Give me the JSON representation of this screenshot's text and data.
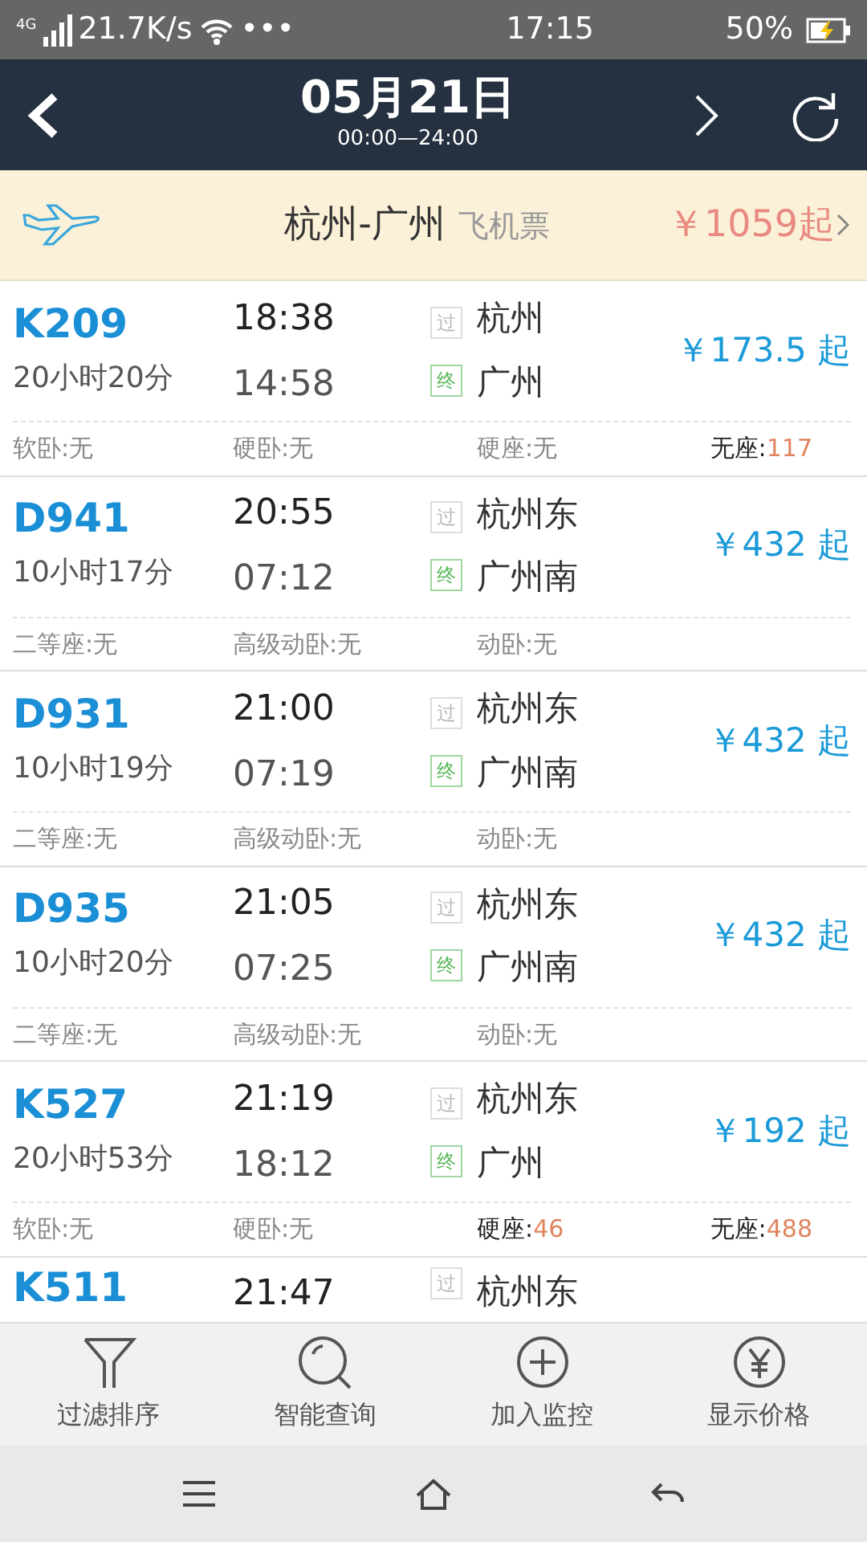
{
  "status_bar": {
    "network": "4G",
    "speed": "21.7K/s",
    "more": "•••",
    "time": "17:15",
    "battery": "50%",
    "charging": true
  },
  "header": {
    "date": "05月21日",
    "time_range": "00:00—24:00"
  },
  "flight_banner": {
    "route": "杭州-广州",
    "label": "飞机票",
    "price": "￥1059起"
  },
  "trains": [
    {
      "number": "K209",
      "duration": "20小时20分",
      "depart": "18:38",
      "arrive": "14:58",
      "from_mark": "过",
      "to_mark": "终",
      "from": "杭州",
      "to": "广州",
      "price": "￥173.5 起",
      "seats": [
        {
          "label": "软卧:",
          "value": "无",
          "available": false
        },
        {
          "label": "硬卧:",
          "value": "无",
          "available": false
        },
        {
          "label": "硬座:",
          "value": "无",
          "available": false
        },
        {
          "label": "无座:",
          "value": "117",
          "available": true
        }
      ]
    },
    {
      "number": "D941",
      "duration": "10小时17分",
      "depart": "20:55",
      "arrive": "07:12",
      "from_mark": "过",
      "to_mark": "终",
      "from": "杭州东",
      "to": "广州南",
      "price": "￥432 起",
      "seats": [
        {
          "label": "二等座:",
          "value": "无",
          "available": false
        },
        {
          "label": "高级动卧:",
          "value": "无",
          "available": false
        },
        {
          "label": "动卧:",
          "value": "无",
          "available": false
        }
      ]
    },
    {
      "number": "D931",
      "duration": "10小时19分",
      "depart": "21:00",
      "arrive": "07:19",
      "from_mark": "过",
      "to_mark": "终",
      "from": "杭州东",
      "to": "广州南",
      "price": "￥432 起",
      "seats": [
        {
          "label": "二等座:",
          "value": "无",
          "available": false
        },
        {
          "label": "高级动卧:",
          "value": "无",
          "available": false
        },
        {
          "label": "动卧:",
          "value": "无",
          "available": false
        }
      ]
    },
    {
      "number": "D935",
      "duration": "10小时20分",
      "depart": "21:05",
      "arrive": "07:25",
      "from_mark": "过",
      "to_mark": "终",
      "from": "杭州东",
      "to": "广州南",
      "price": "￥432 起",
      "seats": [
        {
          "label": "二等座:",
          "value": "无",
          "available": false
        },
        {
          "label": "高级动卧:",
          "value": "无",
          "available": false
        },
        {
          "label": "动卧:",
          "value": "无",
          "available": false
        }
      ]
    },
    {
      "number": "K527",
      "duration": "20小时53分",
      "depart": "21:19",
      "arrive": "18:12",
      "from_mark": "过",
      "to_mark": "终",
      "from": "杭州东",
      "to": "广州",
      "price": "￥192 起",
      "seats": [
        {
          "label": "软卧:",
          "value": "无",
          "available": false
        },
        {
          "label": "硬卧:",
          "value": "无",
          "available": false
        },
        {
          "label": "硬座:",
          "value": "46",
          "available": true
        },
        {
          "label": "无座:",
          "value": "488",
          "available": true
        }
      ]
    },
    {
      "number": "K511",
      "depart": "21:47",
      "from_mark": "过",
      "from": "杭州东"
    }
  ],
  "toolbar": [
    {
      "kind": "filter",
      "label": "过滤排序"
    },
    {
      "kind": "search",
      "label": "智能查询"
    },
    {
      "kind": "add",
      "label": "加入监控"
    },
    {
      "kind": "price",
      "label": "显示价格"
    }
  ],
  "nav_bar": [
    {
      "kind": "menu"
    },
    {
      "kind": "home"
    },
    {
      "kind": "back"
    }
  ]
}
